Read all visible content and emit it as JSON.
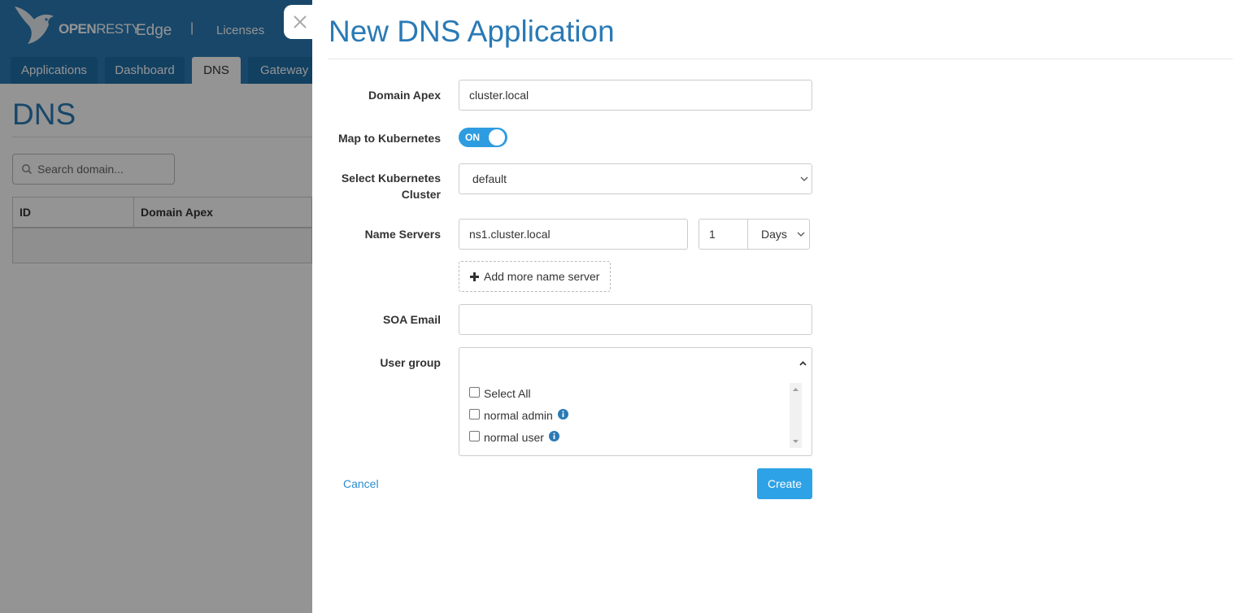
{
  "app": {
    "brand_open": "OPEN",
    "brand_resty": "RESTY",
    "product": "Edge",
    "separator": "|",
    "licenses_label": "Licenses"
  },
  "nav": {
    "tabs": [
      {
        "label": "Applications",
        "active": false
      },
      {
        "label": "Dashboard",
        "active": false
      },
      {
        "label": "DNS",
        "active": true
      },
      {
        "label": "Gateway C",
        "active": false
      }
    ]
  },
  "page": {
    "title": "DNS",
    "search_placeholder": "Search domain...",
    "table_headers": [
      "ID",
      "Domain Apex"
    ]
  },
  "modal": {
    "title": "New DNS Application",
    "domain_apex": {
      "label": "Domain Apex",
      "value": "cluster.local"
    },
    "map_to_kubernetes": {
      "label": "Map to Kubernetes",
      "state_label": "ON",
      "on": true
    },
    "k8s_cluster": {
      "label_line1": "Select Kubernetes",
      "label_line2": "Cluster",
      "value": "default"
    },
    "name_servers": {
      "label": "Name Servers",
      "server": "ns1.cluster.local",
      "ttl_value": "1",
      "ttl_unit": "Days",
      "add_more_label": "Add more name server"
    },
    "soa_email": {
      "label": "SOA Email",
      "value": ""
    },
    "user_group": {
      "label": "User group",
      "options": [
        {
          "label": "Select All",
          "checked": false,
          "info": false
        },
        {
          "label": "normal admin",
          "checked": false,
          "info": true
        },
        {
          "label": "normal user",
          "checked": false,
          "info": true
        }
      ]
    },
    "cancel_label": "Cancel",
    "create_label": "Create"
  },
  "colors": {
    "brand_blue": "#2a7ab5",
    "accent": "#2ea2e6",
    "link": "#2a8ccf",
    "info_icon": "#2a7ab5"
  }
}
